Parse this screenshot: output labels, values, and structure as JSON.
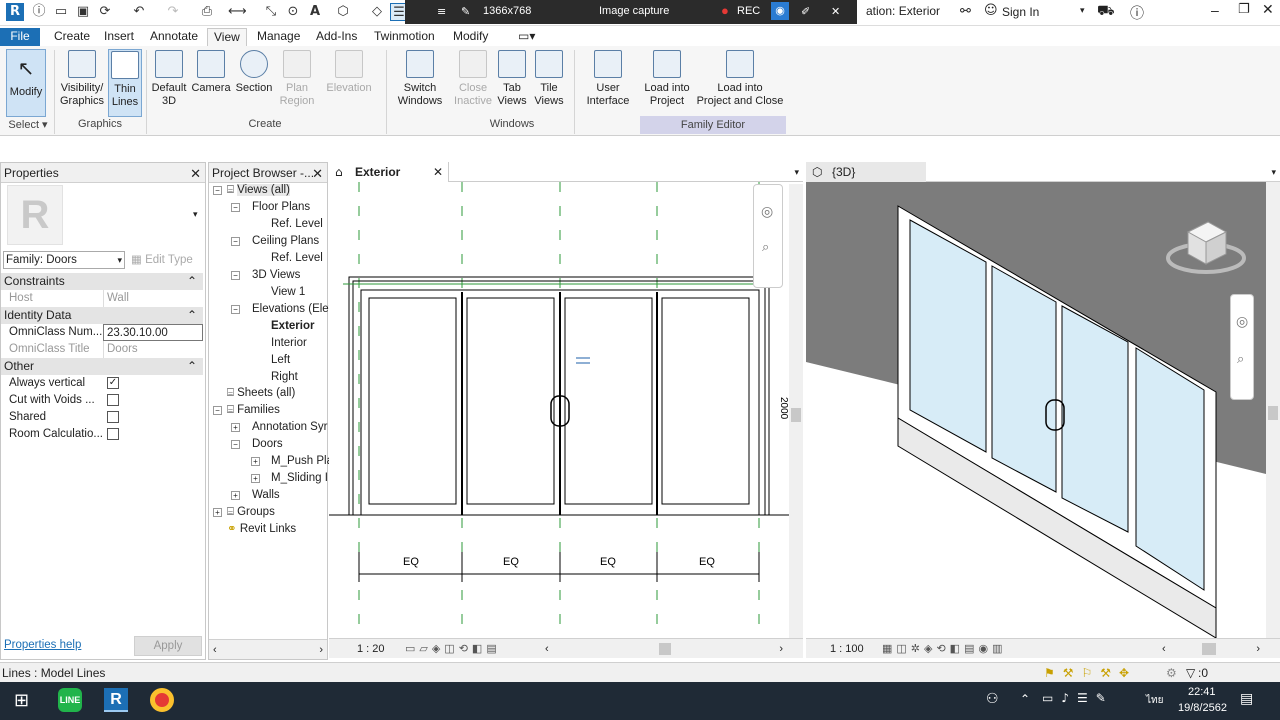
{
  "titlebar": {
    "resolution": "1366x768",
    "capture_label": "Image capture",
    "rec_label": "REC",
    "window_title_fragment": "ation: Exterior",
    "sign_in": "Sign In"
  },
  "menu": {
    "file": "File",
    "tabs": [
      "Create",
      "Insert",
      "Annotate",
      "View",
      "Manage",
      "Add-Ins",
      "Twinmotion",
      "Modify"
    ],
    "active": "View"
  },
  "ribbon": {
    "modify": "Modify",
    "select": "Select",
    "graphics_buttons": [
      {
        "label": "Visibility/\nGraphics"
      },
      {
        "label": "Thin\nLines"
      }
    ],
    "graphics_panel": "Graphics",
    "create_buttons": [
      {
        "label": "Default\n3D"
      },
      {
        "label": "Camera"
      },
      {
        "label": "Section"
      },
      {
        "label": "Plan\nRegion"
      },
      {
        "label": "Elevation"
      }
    ],
    "create_panel": "Create",
    "windows_buttons": [
      {
        "label": "Switch\nWindows"
      },
      {
        "label": "Close\nInactive"
      },
      {
        "label": "Tab\nViews"
      },
      {
        "label": "Tile\nViews"
      }
    ],
    "windows_panel": "Windows",
    "family_buttons": [
      {
        "label": "User\nInterface"
      },
      {
        "label": "Load into\nProject"
      },
      {
        "label": "Load into\nProject and Close"
      }
    ],
    "family_panel": "Family Editor"
  },
  "properties": {
    "title": "Properties",
    "family_select": "Family: Doors",
    "edit_type": "Edit Type",
    "sections": {
      "constraints": "Constraints",
      "identity": "Identity Data",
      "other": "Other"
    },
    "host_k": "Host",
    "host_v": "Wall",
    "omni_num_k": "OmniClass Num...",
    "omni_num_v": "23.30.10.00",
    "omni_title_k": "OmniClass Title",
    "omni_title_v": "Doors",
    "always_vertical": "Always vertical",
    "cut_with_voids": "Cut with Voids ...",
    "shared": "Shared",
    "room_calc": "Room Calculatio...",
    "help": "Properties help",
    "apply": "Apply"
  },
  "browser": {
    "title": "Project Browser -...",
    "views_all": "Views (all)",
    "floor_plans": "Floor Plans",
    "ref_level_1": "Ref. Level",
    "ceiling_plans": "Ceiling Plans",
    "ref_level_2": "Ref. Level",
    "views_3d": "3D Views",
    "view1": "View 1",
    "elevations": "Elevations (Elev",
    "exterior": "Exterior",
    "interior": "Interior",
    "left": "Left",
    "right": "Right",
    "sheets": "Sheets (all)",
    "families": "Families",
    "annotation": "Annotation Syr",
    "doors": "Doors",
    "m_push": "M_Push Pla",
    "m_sliding": "M_Sliding I",
    "walls": "Walls",
    "groups": "Groups",
    "revit_links": "Revit Links"
  },
  "elevation_view": {
    "tab": "Exterior",
    "scale": "1 : 20",
    "eq_labels": [
      "EQ",
      "EQ",
      "EQ",
      "EQ"
    ],
    "height_dim": "2000"
  },
  "view3d": {
    "tab": "{3D}",
    "scale": "1 : 100"
  },
  "status": {
    "text": "Lines : Model Lines",
    "filter": ":0"
  },
  "taskbar": {
    "time": "22:41",
    "date": "19/8/2562",
    "lang": "ไทย"
  },
  "colors": {
    "accent": "#1c6fb5",
    "glass": "#d7ecf7",
    "ref_plane": "#2e9a3a",
    "family_editor_panel": "#d3d3ea"
  }
}
